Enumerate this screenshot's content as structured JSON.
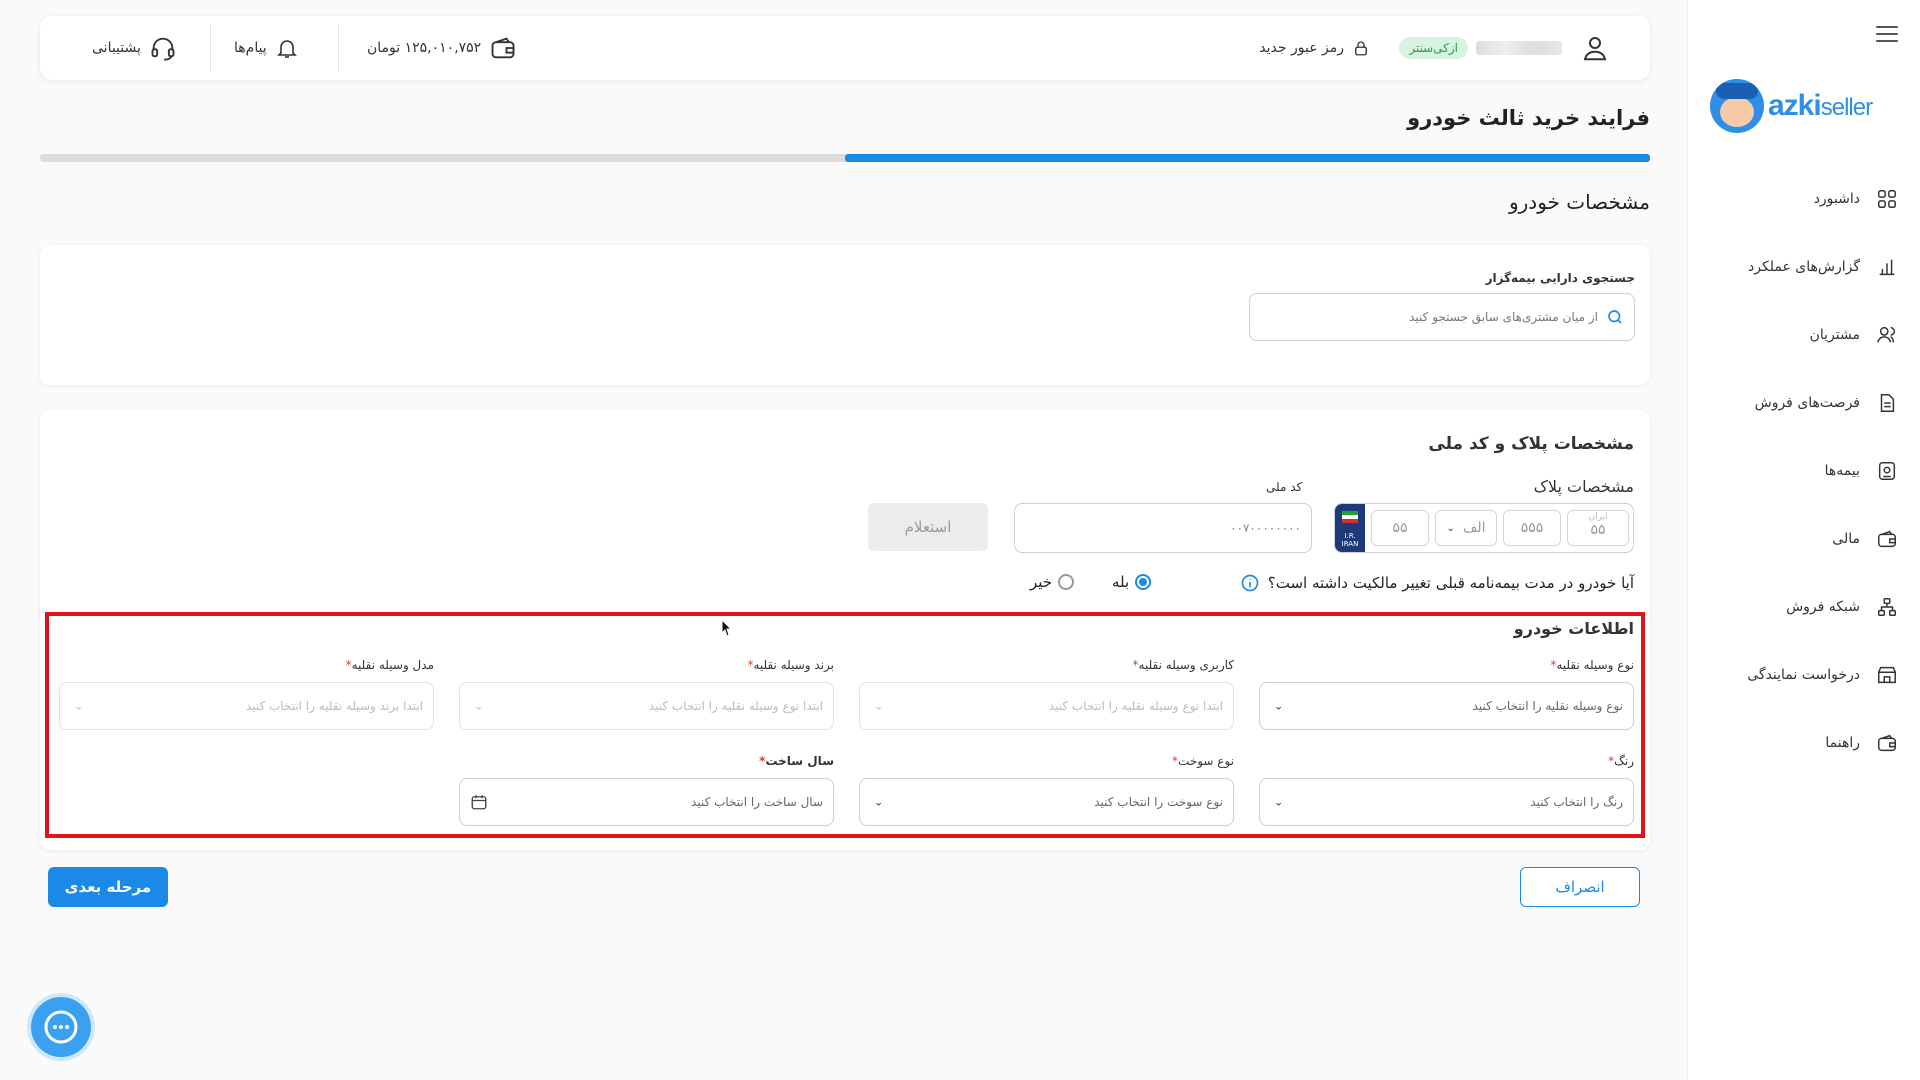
{
  "sidebar": {
    "logo": {
      "text_main": "azki",
      "text_sub": "seller"
    },
    "items": [
      {
        "label": "داشبورد",
        "icon": "dashboard-icon"
      },
      {
        "label": "گزارش‌های عملکرد",
        "icon": "chart-bar-icon"
      },
      {
        "label": "مشتریان",
        "icon": "users-icon"
      },
      {
        "label": "فرصت‌های فروش",
        "icon": "document-icon"
      },
      {
        "label": "بیمه‌ها",
        "icon": "insurance-icon"
      },
      {
        "label": "مالی",
        "icon": "wallet-icon"
      },
      {
        "label": "شبکه فروش",
        "icon": "network-icon"
      },
      {
        "label": "درخواست نمایندگی",
        "icon": "store-icon"
      },
      {
        "label": "راهنما",
        "icon": "guide-icon"
      }
    ]
  },
  "header": {
    "badge": "ازکی‌سنتر",
    "new_password": "رمز عبور جدید",
    "balance": "۱۲۵,۰۱۰,۷۵۲ تومان",
    "messages": "پیام‌ها",
    "support": "پشتیبانی"
  },
  "page": {
    "title": "فرایند خرید ثالث خودرو",
    "progress_percent": 50,
    "section_title": "مشخصات خودرو"
  },
  "search_card": {
    "label": "جستجوی دارایی بیمه‌گزار",
    "placeholder": "از میان مشتری‌های سابق جستجو کنید"
  },
  "plate_card": {
    "title": "مشخصات پلاک و کد ملی",
    "plate_label": "مشخصات پلاک",
    "plate": {
      "iran_label": "ایران",
      "iran_code": "۵۵",
      "three_digits": "۵۵۵",
      "letter": "الف",
      "two_digits": "۵۵",
      "flag_text": "I.R. IRAN"
    },
    "national_code_label": "کد ملی",
    "national_code_placeholder": "۰۰۷۰۰۰۰۰۰۰۰",
    "inquiry_button": "استعلام",
    "ownership_question": "آیا خودرو در مدت بیمه‌نامه قبلی تغییر مالکیت داشته است؟",
    "yes": "بله",
    "no": "خیر",
    "selected": "yes"
  },
  "vehicle_info": {
    "title": "اطلاعات خودرو",
    "fields": [
      {
        "label": "نوع وسیله نقلیه",
        "placeholder": "نوع وسیله نقلیه را انتخاب کنید",
        "enabled": true
      },
      {
        "label": "کاربری وسیله نقلیه",
        "placeholder": "ابتدا نوع وسیله نقلیه را انتخاب کنید",
        "enabled": false
      },
      {
        "label": "برند وسیله نقلیه",
        "placeholder": "ابتدا نوع وسیله نقلیه را انتخاب کنید",
        "enabled": false
      },
      {
        "label": "مدل وسیله نقلیه",
        "placeholder": "ابتدا برند وسیله نقلیه را انتخاب کنید",
        "enabled": false
      },
      {
        "label": "رنگ",
        "placeholder": "رنگ را انتخاب کنید",
        "enabled": true
      },
      {
        "label": "نوع سوخت",
        "placeholder": "نوع سوخت را انتخاب کنید",
        "enabled": true
      },
      {
        "label": "سال ساخت",
        "placeholder": "سال ساخت را انتخاب کنید",
        "enabled": true
      }
    ]
  },
  "footer": {
    "cancel": "انصراف",
    "next": "مرحله بعدی"
  },
  "colors": {
    "primary": "#1a8ae6",
    "highlight": "#e0131b",
    "green_badge": "#23a047"
  }
}
